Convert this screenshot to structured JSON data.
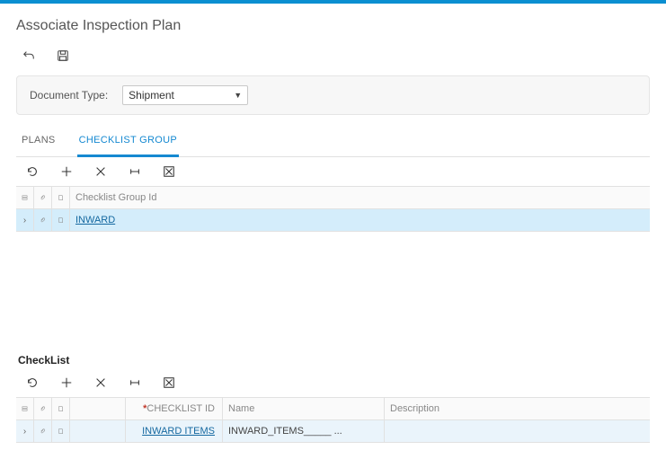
{
  "title": "Associate Inspection Plan",
  "filter": {
    "label": "Document Type:",
    "value": "Shipment"
  },
  "tabs": {
    "plans": "PLANS",
    "checklist_group": "CHECKLIST GROUP"
  },
  "grid1": {
    "header": "Checklist Group Id",
    "rows": [
      {
        "id": "INWARD"
      }
    ]
  },
  "section2": {
    "title": "CheckList"
  },
  "grid2": {
    "headers": {
      "checklist_id": "CHECKLIST ID",
      "name": "Name",
      "description": "Description"
    },
    "rows": [
      {
        "id": "INWARD ITEMS",
        "name": "INWARD_ITEMS_____ ...",
        "description": ""
      }
    ]
  }
}
